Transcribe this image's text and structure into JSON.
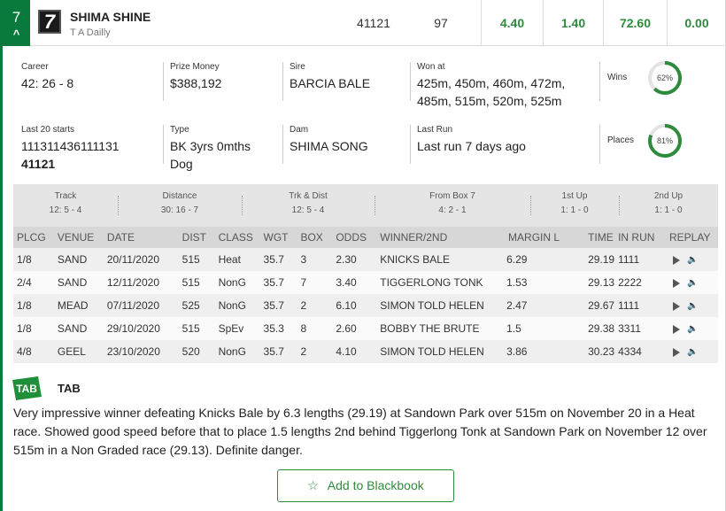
{
  "runner": {
    "box_number": "7",
    "rug_number": "7",
    "name": "SHIMA SHINE",
    "trainer": "T A Dailly",
    "last_form": "41121",
    "bsp": "97",
    "odds": [
      "4.40",
      "1.40",
      "72.60",
      "0.00"
    ]
  },
  "info": {
    "career": {
      "label": "Career",
      "value": "42: 26 - 8"
    },
    "prize_money": {
      "label": "Prize Money",
      "value": "$388,192"
    },
    "sire": {
      "label": "Sire",
      "value": "BARCIA BALE"
    },
    "won_at": {
      "label": "Won at",
      "value_line1": "425m, 450m, 460m, 472m,",
      "value_line2": "485m, 515m, 520m, 525m"
    },
    "wins": {
      "label": "Wins",
      "percent_text": "62%",
      "percent": 62
    },
    "last20": {
      "label": "Last 20 starts",
      "value": "111311436111131",
      "value_bold": "41121"
    },
    "type": {
      "label": "Type",
      "value_line1": "BK 3yrs 0mths",
      "value_line2": "Dog"
    },
    "dam": {
      "label": "Dam",
      "value": "SHIMA SONG"
    },
    "last_run": {
      "label": "Last Run",
      "value": "Last run 7 days ago"
    },
    "places": {
      "label": "Places",
      "percent_text": "81%",
      "percent": 81
    }
  },
  "stats": [
    {
      "title": "Track",
      "value": "12: 5 - 4"
    },
    {
      "title": "Distance",
      "value": "30: 16 - 7"
    },
    {
      "title": "Trk & Dist",
      "value": "12: 5 - 4"
    },
    {
      "title": "From Box 7",
      "value": "4: 2 - 1"
    },
    {
      "title": "1st Up",
      "value": "1: 1 - 0"
    },
    {
      "title": "2nd Up",
      "value": "1: 1 - 0"
    }
  ],
  "results": {
    "headers": [
      "PLCG",
      "VENUE",
      "DATE",
      "DIST",
      "CLASS",
      "WGT",
      "BOX",
      "ODDS",
      "WINNER/2ND",
      "MARGIN L",
      "TIME",
      "IN RUN",
      "REPLAY"
    ],
    "rows": [
      [
        "1/8",
        "SAND",
        "20/11/2020",
        "515",
        "Heat",
        "35.7",
        "3",
        "2.30",
        "KNICKS BALE",
        "6.29",
        "29.19",
        "1111"
      ],
      [
        "2/4",
        "SAND",
        "12/11/2020",
        "515",
        "NonG",
        "35.7",
        "7",
        "3.40",
        "TIGGERLONG TONK",
        "1.53",
        "29.13",
        "2222"
      ],
      [
        "1/8",
        "MEAD",
        "07/11/2020",
        "525",
        "NonG",
        "35.7",
        "2",
        "6.10",
        "SIMON TOLD HELEN",
        "2.47",
        "29.67",
        "1111"
      ],
      [
        "1/8",
        "SAND",
        "29/10/2020",
        "515",
        "SpEv",
        "35.3",
        "8",
        "2.60",
        "BOBBY THE BRUTE",
        "1.5",
        "29.38",
        "3311"
      ],
      [
        "4/8",
        "GEEL",
        "23/10/2020",
        "520",
        "NonG",
        "35.7",
        "2",
        "4.10",
        "SIMON TOLD HELEN",
        "3.86",
        "30.23",
        "4334"
      ]
    ]
  },
  "comment": {
    "logo_text": "TAB",
    "source": "TAB",
    "text": "Very impressive winner defeating Knicks Bale by 6.3 lengths (29.19) at Sandown Park over 515m on November 20 in a Heat race. Showed good speed before that to place 1.5 lengths 2nd behind Tiggerlong Tonk at Sandown Park on November 12 over 515m in a Non Graded race (29.13). Definite danger."
  },
  "blackbook_button": "Add to Blackbook",
  "colors": {
    "brand_green": "#0a7a3c",
    "odds_green": "#2e8b3b"
  }
}
